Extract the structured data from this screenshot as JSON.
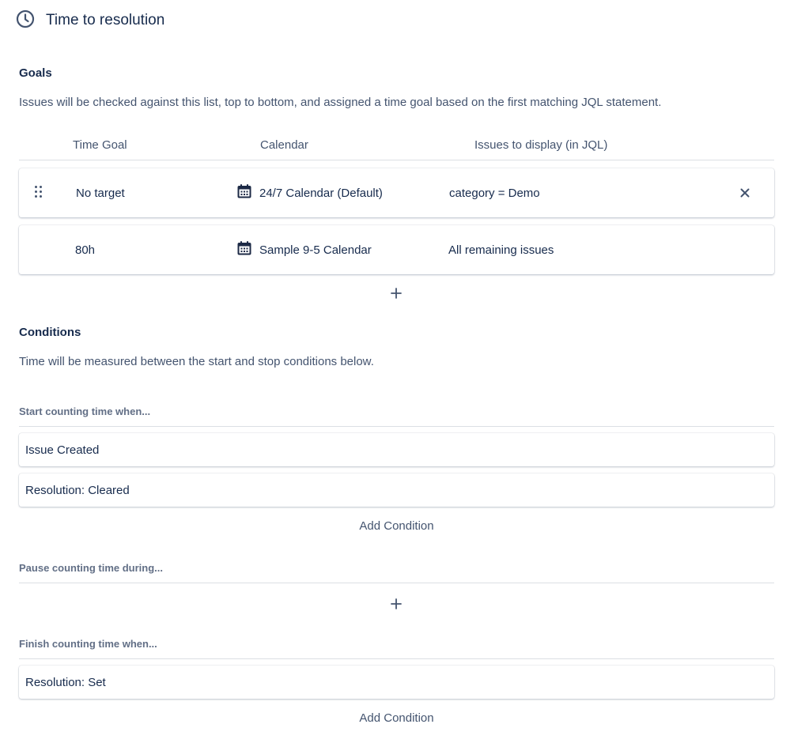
{
  "header": {
    "title": "Time to resolution",
    "icon": "clock-icon"
  },
  "goals": {
    "heading": "Goals",
    "description": "Issues will be checked against this list, top to bottom, and assigned a time goal based on the first matching JQL statement.",
    "columns": {
      "time_goal": "Time Goal",
      "calendar": "Calendar",
      "jql": "Issues to display (in JQL)"
    },
    "rows": [
      {
        "time_goal": "No target",
        "calendar": "24/7 Calendar (Default)",
        "jql": "category = Demo"
      },
      {
        "time_goal": "80h",
        "calendar": "Sample 9-5 Calendar",
        "jql": "All remaining issues"
      }
    ]
  },
  "conditions": {
    "heading": "Conditions",
    "description": "Time will be measured between the start and stop conditions below.",
    "start": {
      "heading": "Start counting time when...",
      "items": [
        "Issue Created",
        "Resolution: Cleared"
      ],
      "add_label": "Add Condition"
    },
    "pause": {
      "heading": "Pause counting time during..."
    },
    "finish": {
      "heading": "Finish counting time when...",
      "items": [
        "Resolution: Set"
      ],
      "add_label": "Add Condition"
    }
  },
  "colors": {
    "text": "#172b4d",
    "subtle": "#44546f",
    "border": "#dcdfe4"
  }
}
